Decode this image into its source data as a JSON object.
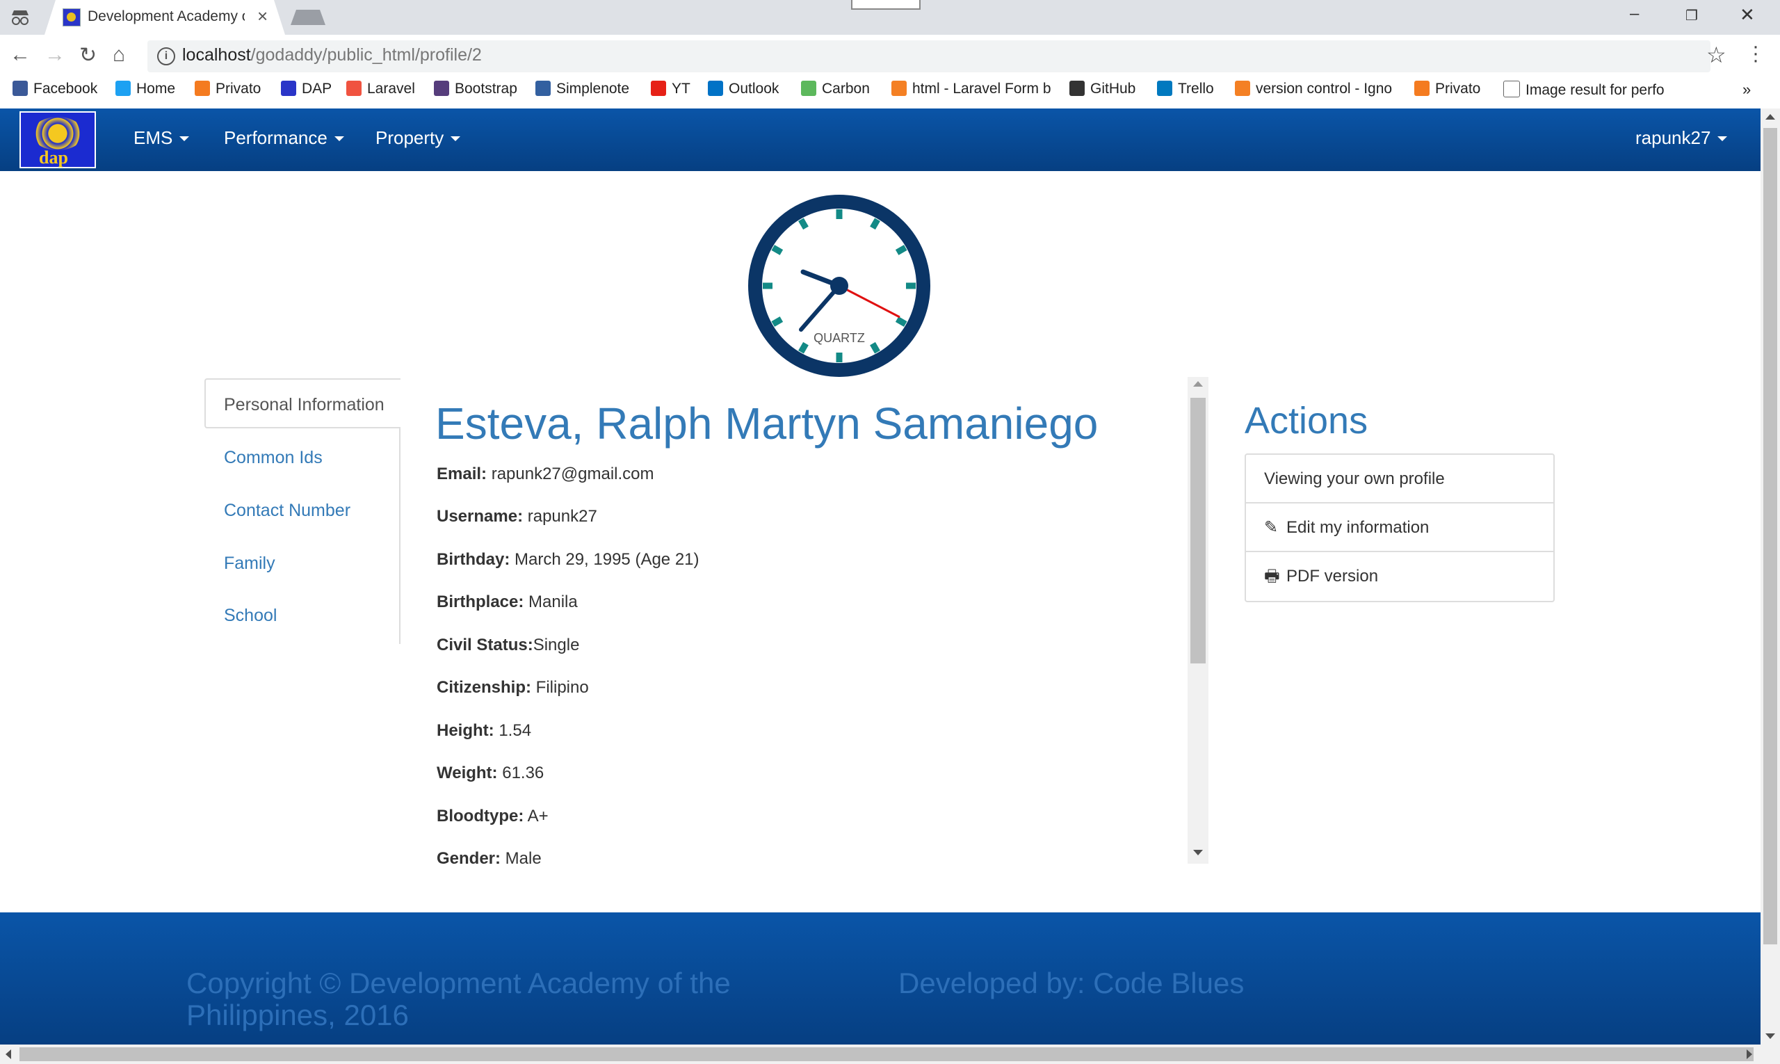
{
  "browser": {
    "tab_title": "Development Academy of the Philippines",
    "url_host": "localhost",
    "url_path": "/godaddy/public_html/profile/2",
    "bookmarks": [
      {
        "label": "Facebook",
        "icon": "facebook-icon",
        "color": "#3b5998"
      },
      {
        "label": "Home",
        "icon": "twitter-icon",
        "color": "#1da1f2"
      },
      {
        "label": "Privato",
        "icon": "privato-icon",
        "color": "#f47b20"
      },
      {
        "label": "DAP",
        "icon": "dap-icon",
        "color": "#2a35c8"
      },
      {
        "label": "Laravel",
        "icon": "laravel-icon",
        "color": "#f05340"
      },
      {
        "label": "Bootstrap",
        "icon": "bootstrap-icon",
        "color": "#563d7c"
      },
      {
        "label": "Simplenote",
        "icon": "simplenote-icon",
        "color": "#3360a0"
      },
      {
        "label": "YT",
        "icon": "youtube-icon",
        "color": "#e62117"
      },
      {
        "label": "Outlook",
        "icon": "outlook-icon",
        "color": "#0072c6"
      },
      {
        "label": "Carbon",
        "icon": "carbon-icon",
        "color": "#5cb85c"
      },
      {
        "label": "html - Laravel Form b",
        "icon": "stackoverflow-icon",
        "color": "#f48024"
      },
      {
        "label": "GitHub",
        "icon": "github-icon",
        "color": "#333333"
      },
      {
        "label": "Trello",
        "icon": "trello-icon",
        "color": "#0079bf"
      },
      {
        "label": "version control - Igno",
        "icon": "stackoverflow-icon",
        "color": "#f48024"
      },
      {
        "label": "Privato",
        "icon": "privato-icon",
        "color": "#f47b20"
      },
      {
        "label": "Image result for perfo",
        "icon": "page-icon",
        "color": "#ffffff"
      }
    ],
    "more_bookmarks": "»"
  },
  "navbar": {
    "logo_text": "dap",
    "menus": [
      "EMS",
      "Performance",
      "Property"
    ],
    "user": "rapunk27"
  },
  "clock": {
    "label": "QUARTZ"
  },
  "sidebar": {
    "tabs": [
      "Personal Information",
      "Common Ids",
      "Contact Number",
      "Family",
      "School"
    ]
  },
  "profile": {
    "name": "Esteva, Ralph Martyn Samaniego",
    "fields": [
      {
        "label": "Email:",
        "value": " rapunk27@gmail.com"
      },
      {
        "label": "Username:",
        "value": " rapunk27"
      },
      {
        "label": "Birthday:",
        "value": " March 29, 1995 (Age 21)"
      },
      {
        "label": "Birthplace:",
        "value": " Manila"
      },
      {
        "label": "Civil Status:",
        "value": "Single"
      },
      {
        "label": "Citizenship:",
        "value": " Filipino"
      },
      {
        "label": "Height:",
        "value": " 1.54"
      },
      {
        "label": "Weight:",
        "value": " 61.36"
      },
      {
        "label": "Bloodtype:",
        "value": " A+"
      },
      {
        "label": "Gender:",
        "value": " Male"
      }
    ]
  },
  "actions": {
    "title": "Actions",
    "items": [
      {
        "label": "Viewing your own profile",
        "icon": ""
      },
      {
        "label": "Edit my information",
        "icon": "pencil-icon"
      },
      {
        "label": "PDF version",
        "icon": "print-icon"
      }
    ]
  },
  "footer": {
    "copyright_line1": "Copyright © Development Academy of the",
    "copyright_line2": "Philippines, 2016",
    "developed_by": "Developed by: Code Blues"
  },
  "colors": {
    "navbar": "#0a55a8",
    "link": "#337ab7",
    "footer_text": "#2d6fb8"
  }
}
